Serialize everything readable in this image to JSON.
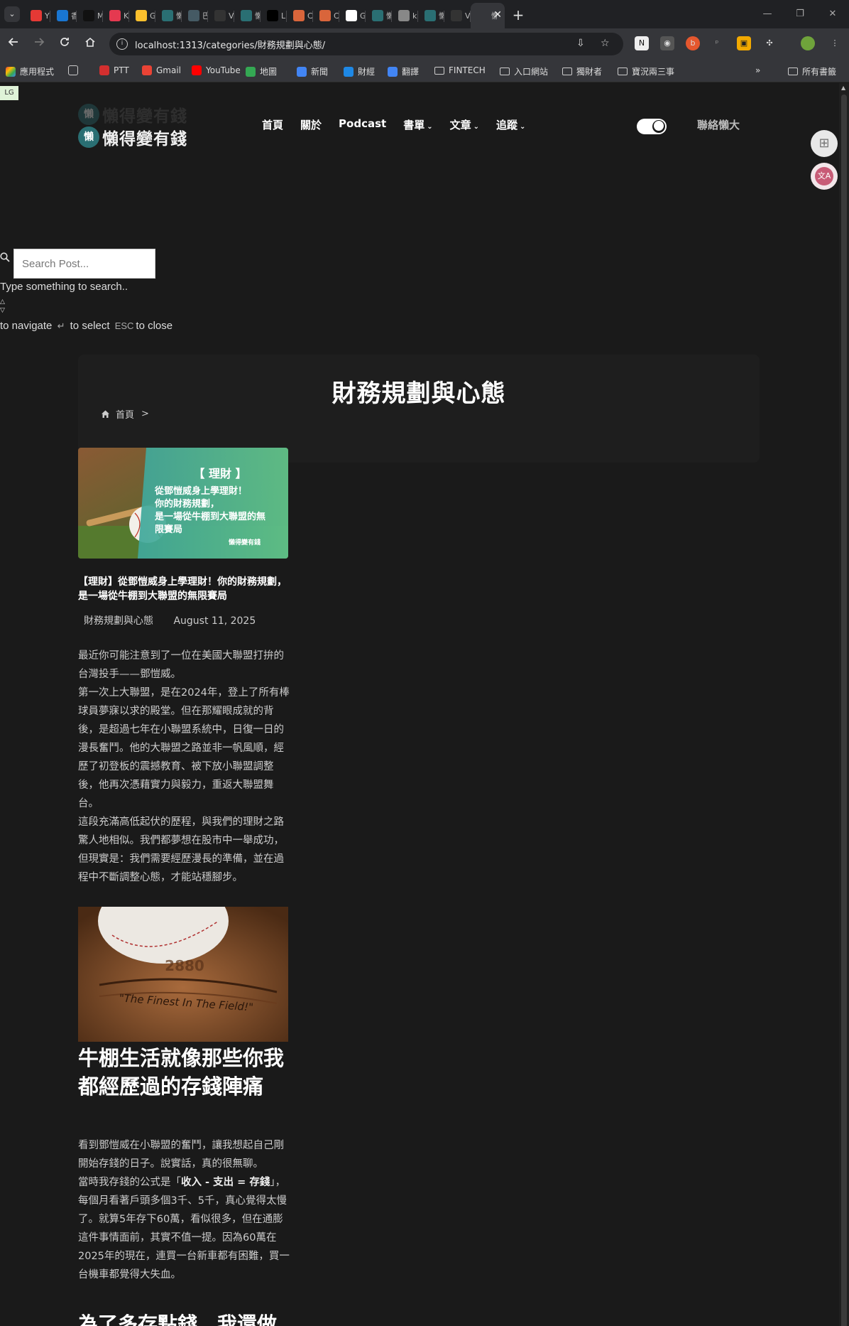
{
  "browser": {
    "tabs": [
      {
        "title": "Y",
        "color": "#e53935"
      },
      {
        "title": "香",
        "color": "#1976d2"
      },
      {
        "title": "Medium",
        "color": "#111111"
      },
      {
        "title": "K",
        "color": "#e53950"
      },
      {
        "title": "G",
        "color": "#fbc02d"
      },
      {
        "title": "懶",
        "color": "#2a6f73"
      },
      {
        "title": "巴",
        "color": "#455a64"
      },
      {
        "title": "V",
        "color": "#333333"
      },
      {
        "title": "懶",
        "color": "#2a6f73"
      },
      {
        "title": "L",
        "color": "#000000"
      },
      {
        "title": "C",
        "color": "#d9653b"
      },
      {
        "title": "C",
        "color": "#d9653b"
      },
      {
        "title": "G",
        "color": "#ffffff"
      },
      {
        "title": "懶",
        "color": "#2a6f73"
      },
      {
        "title": "k",
        "color": "#888888"
      },
      {
        "title": "懶",
        "color": "#2a6f73"
      },
      {
        "title": "V",
        "color": "#333333"
      }
    ],
    "active_tab": {
      "title": "懶",
      "close": "✕"
    },
    "new_tab": "+",
    "window_controls": {
      "minimize": "—",
      "restore": "❐",
      "close": "✕"
    },
    "url": "localhost:1313/categories/財務規劃與心態/",
    "bookmarks": [
      {
        "label": "應用程式",
        "type": "apps"
      },
      {
        "label": "",
        "type": "grid"
      },
      {
        "label": "PTT",
        "type": "site",
        "color": "#d32f2f"
      },
      {
        "label": "Gmail",
        "type": "site",
        "color": "#ea4335"
      },
      {
        "label": "YouTube",
        "type": "site",
        "color": "#ff0000"
      },
      {
        "label": "地圖",
        "type": "site",
        "color": "#34a853"
      },
      {
        "label": "新聞",
        "type": "site",
        "color": "#4285f4"
      },
      {
        "label": "財經",
        "type": "site",
        "color": "#1e88e5"
      },
      {
        "label": "翻譯",
        "type": "site",
        "color": "#4285f4"
      },
      {
        "label": "FINTECH",
        "type": "folder"
      },
      {
        "label": "入口網站",
        "type": "folder"
      },
      {
        "label": "獨財者",
        "type": "folder"
      },
      {
        "label": "寶況兩三事",
        "type": "folder"
      }
    ],
    "bookmarks_more": "»",
    "all_bookmarks": "所有書籤"
  },
  "site": {
    "lg_badge": "LG",
    "logo_char": "懶",
    "logo_text": "懶得變有錢",
    "nav": [
      {
        "label": "首頁",
        "dropdown": false
      },
      {
        "label": "關於",
        "dropdown": false
      },
      {
        "label": "Podcast",
        "dropdown": false
      },
      {
        "label": "書單",
        "dropdown": true
      },
      {
        "label": "文章",
        "dropdown": true
      },
      {
        "label": "追蹤",
        "dropdown": true
      }
    ],
    "contact": "聯絡懶大",
    "side_tool_b": "文A"
  },
  "search": {
    "placeholder": "Search Post...",
    "hint": "Type something to search..",
    "nav_help_1": "to navigate",
    "enter_key": "↵",
    "nav_help_2": "to select",
    "esc_key": "ESC",
    "nav_help_3": "to close"
  },
  "category": {
    "title": "財務規劃與心態",
    "breadcrumb_home": "首頁",
    "breadcrumb_sep": ">"
  },
  "post": {
    "image_tag": "【 理財 】",
    "image_lines": [
      "從鄧愷威身上學理財！",
      "你的財務規劃，",
      "是一場從牛棚到大聯盟的無",
      "限賽局"
    ],
    "image_brand": "懶得變有錢",
    "title": "【理財】從鄧愷威身上學理財！你的財務規劃，是一場從牛棚到大聯盟的無限賽局",
    "category": "財務規劃與心態",
    "date": "August 11, 2025",
    "p1": "最近你可能注意到了一位在美國大聯盟打拚的台灣投手——鄧愷威。",
    "p2": "第一次上大聯盟，是在2024年，登上了所有棒球員夢寐以求的殿堂。但在那耀眼成就的背後，是超過七年在小聯盟系統中，日復一日的漫長奮鬥。他的大聯盟之路並非一帆風順，經歷了初登板的震撼教育、被下放小聯盟調整後，他再次憑藉實力與毅力，重返大聯盟舞台。",
    "p3": "這段充滿高低起伏的歷程，與我們的理財之路驚人地相似。我們都夢想在股市中一舉成功，但現實是：我們需要經歷漫長的準備，並在過程中不斷調整心態，才能站穩腳步。",
    "photo_caption": "\"The Finest In The Field!\"",
    "photo_brand": "2880",
    "h2": "牛棚生活就像那些你我都經歷過的存錢陣痛",
    "p4": "看到鄧愷威在小聯盟的奮鬥，讓我想起自己剛開始存錢的日子。說實話，真的很無聊。",
    "p5_pre": "當時我存錢的公式是「",
    "p5_strong": "收入 - 支出 = 存錢",
    "p5_post": "」，每個月看著戶頭多個3千、5千，真心覺得太慢了。就算5年存下60萬，看似很多，但在通膨這件事情面前，其實不值一提。因為60萬在2025年的現在，連買一台新車都有困難，買一台機車都覺得大失血。",
    "h2b": "為了多存點錢，我還做"
  }
}
